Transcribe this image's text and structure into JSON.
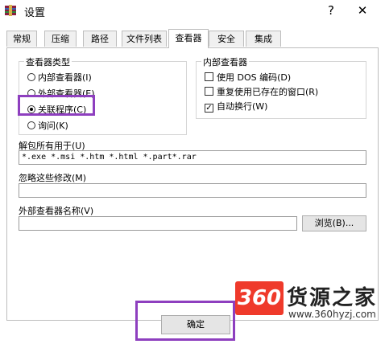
{
  "window": {
    "title": "设置",
    "help_label": "?",
    "close_label": "✕"
  },
  "tabs": [
    {
      "label": "常规"
    },
    {
      "label": "压缩"
    },
    {
      "label": "路径"
    },
    {
      "label": "文件列表"
    },
    {
      "label": "查看器",
      "active": true
    },
    {
      "label": "安全"
    },
    {
      "label": "集成"
    }
  ],
  "viewer_type": {
    "title": "查看器类型",
    "options": [
      {
        "label": "内部查看器(I)",
        "selected": false
      },
      {
        "label": "外部查看器(E)",
        "selected": false
      },
      {
        "label": "关联程序(C)",
        "selected": true
      },
      {
        "label": "询问(K)",
        "selected": false
      }
    ]
  },
  "internal_viewer": {
    "title": "内部查看器",
    "options": [
      {
        "label": "使用 DOS 编码(D)",
        "checked": false
      },
      {
        "label": "重复使用已存在的窗口(R)",
        "checked": false
      },
      {
        "label": "自动换行(W)",
        "checked": true
      }
    ]
  },
  "unpack_for": {
    "label": "解包所有用于(U)",
    "value": "*.exe *.msi *.htm *.html *.part*.rar"
  },
  "ignore_changes": {
    "label": "忽略这些修改(M)",
    "value": ""
  },
  "external_viewer": {
    "label": "外部查看器名称(V)",
    "value": "",
    "browse_label": "浏览(B)..."
  },
  "footer": {
    "ok_label": "确定"
  },
  "watermark": {
    "logo": "360",
    "text": "货源之家",
    "url": "www.360hyzj.com"
  },
  "colors": {
    "highlight": "#8e3fbf",
    "logo_red": "#ef3a2b"
  },
  "icons": {
    "app": "winrar-icon"
  }
}
